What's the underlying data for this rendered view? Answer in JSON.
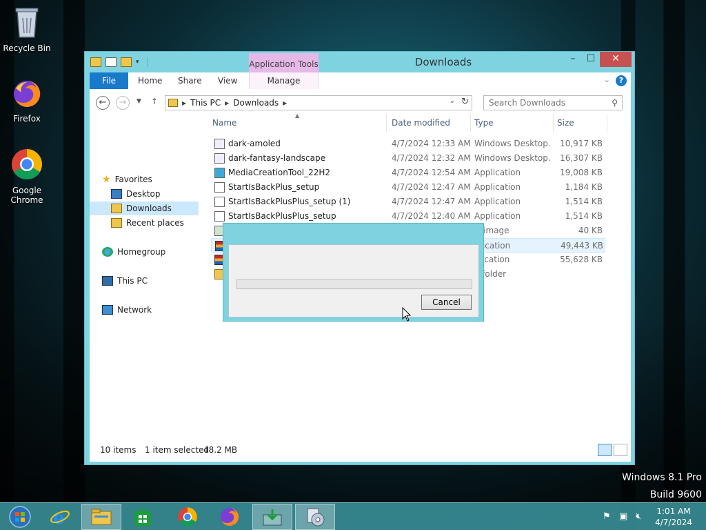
{
  "desktop": {
    "icons": [
      {
        "label": "Recycle Bin",
        "icon": "recycle-bin-icon"
      },
      {
        "label": "Firefox",
        "icon": "firefox-icon"
      },
      {
        "label": "Google Chrome",
        "icon": "chrome-icon"
      }
    ],
    "watermark": {
      "line1": "Windows 8.1 Pro",
      "line2": "Build 9600"
    }
  },
  "window": {
    "title": "Downloads",
    "contextual_tab_group": "Application Tools",
    "ribbon_tabs": [
      "File",
      "Home",
      "Share",
      "View",
      "Manage"
    ],
    "address": {
      "segments": [
        "This PC",
        "Downloads"
      ]
    },
    "search": {
      "placeholder": "Search Downloads"
    },
    "accent_color": "#1979ca"
  },
  "sidebar": {
    "items": [
      {
        "label": "Favorites",
        "icon": "star-icon"
      },
      {
        "label": "Desktop",
        "icon": "desktop-icon"
      },
      {
        "label": "Downloads",
        "icon": "downloads-folder-icon",
        "selected": true
      },
      {
        "label": "Recent places",
        "icon": "recent-places-icon"
      },
      {
        "label": "Homegroup",
        "icon": "homegroup-icon"
      },
      {
        "label": "This PC",
        "icon": "this-pc-icon"
      },
      {
        "label": "Network",
        "icon": "network-icon"
      }
    ]
  },
  "filelist": {
    "columns": [
      "Name",
      "Date modified",
      "Type",
      "Size"
    ],
    "rows": [
      {
        "name": "dark-amoled",
        "date": "4/7/2024 12:33 AM",
        "type": "Windows Desktop...",
        "size": "10,917 KB",
        "icon": "theme-file-icon"
      },
      {
        "name": "dark-fantasy-landscape",
        "date": "4/7/2024 12:32 AM",
        "type": "Windows Desktop...",
        "size": "16,307 KB",
        "icon": "theme-file-icon"
      },
      {
        "name": "MediaCreationTool_22H2",
        "date": "4/7/2024 12:54 AM",
        "type": "Application",
        "size": "19,008 KB",
        "icon": "media-creation-tool-icon"
      },
      {
        "name": "StartIsBackPlus_setup",
        "date": "4/7/2024 12:47 AM",
        "type": "Application",
        "size": "1,184 KB",
        "icon": "installer-icon"
      },
      {
        "name": "StartIsBackPlusPlus_setup (1)",
        "date": "4/7/2024 12:47 AM",
        "type": "Application",
        "size": "1,514 KB",
        "icon": "installer-icon"
      },
      {
        "name": "StartIsBackPlusPlus_setup",
        "date": "4/7/2024 12:40 AM",
        "type": "Application",
        "size": "1,514 KB",
        "icon": "installer-icon"
      },
      {
        "name": "",
        "date": "",
        "type": "G image",
        "size": "40 KB",
        "icon": "image-file-icon"
      },
      {
        "name": "",
        "date": "",
        "type": "plication",
        "size": "49,443 KB",
        "icon": "winrar-icon",
        "selected": true
      },
      {
        "name": "",
        "date": "",
        "type": "plication",
        "size": "55,628 KB",
        "icon": "winrar-icon"
      },
      {
        "name": "",
        "date": "",
        "type": "e folder",
        "size": "",
        "icon": "folder-icon"
      }
    ]
  },
  "status": {
    "items_count": "10 items",
    "selection": "1 item selected",
    "selection_size": "48.2 MB"
  },
  "dialog": {
    "cancel_label": "Cancel",
    "progress": 0
  },
  "taskbar": {
    "buttons": [
      "start-button-icon",
      "internet-explorer-icon",
      "file-explorer-icon",
      "store-icon",
      "chrome-icon",
      "firefox-icon",
      "installer-task-icon",
      "setup-task-icon"
    ],
    "clock": {
      "time": "1:01 AM",
      "date": "4/7/2024"
    }
  }
}
